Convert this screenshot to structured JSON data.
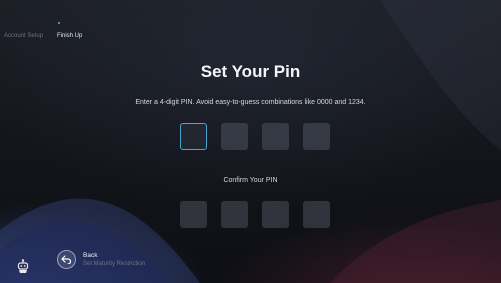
{
  "steps": {
    "previous": "Account Setup",
    "current": "Finish Up"
  },
  "title": "Set Your Pin",
  "subtitle": "Enter a 4-digit PIN. Avoid easy-to-guess combinations like 0000 and 1234.",
  "pin_entry": {
    "digits": [
      "",
      "",
      "",
      ""
    ],
    "active_index": 0
  },
  "confirm_label": "Confirm Your PIN",
  "pin_confirm": {
    "digits": [
      "",
      "",
      "",
      ""
    ]
  },
  "back": {
    "label": "Back",
    "sublabel": "Set Maturity Restriction",
    "icon": "back-arrow-icon"
  },
  "mascot_icon": "mascot-icon",
  "colors": {
    "accent": "#4ba3d3",
    "text": "#ffffff",
    "muted": "#6f7480"
  }
}
